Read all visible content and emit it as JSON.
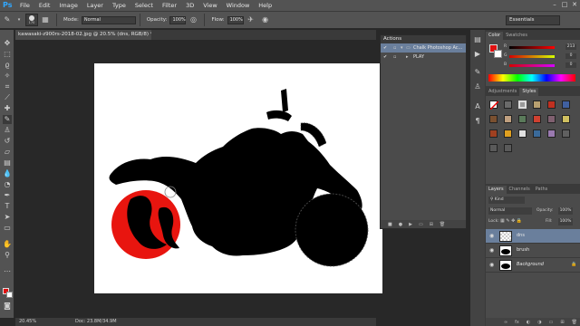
{
  "app": {
    "logo": "Ps",
    "menu": [
      "File",
      "Edit",
      "Image",
      "Layer",
      "Type",
      "Select",
      "Filter",
      "3D",
      "View",
      "Window",
      "Help"
    ],
    "window_controls": [
      "–",
      "□",
      "✕"
    ]
  },
  "options": {
    "brush_size": "170",
    "mode_label": "Mode:",
    "mode_value": "Normal",
    "opacity_label": "Opacity:",
    "opacity_value": "100%",
    "flow_label": "Flow:",
    "flow_value": "100%",
    "workspace": "Essentials"
  },
  "document": {
    "tab_title": "kawasaki-z900rs-2018-02.jpg @ 20.5% (dns, RGB/8) *",
    "zoom": "20.45%",
    "doc_info": "Doc: 23.8M/34.9M"
  },
  "colors": {
    "foreground": "#e01010",
    "background": "#ffffff",
    "accent_selected": "#6a7f9c"
  },
  "actions_panel": {
    "title": "Actions",
    "rows": [
      {
        "label": "Chalk Photoshop Ac...",
        "checked": "✔",
        "selected": true
      },
      {
        "label": "PLAY",
        "checked": "✔",
        "selected": false
      }
    ]
  },
  "color_panel": {
    "tabs": [
      "Color",
      "Swatches"
    ],
    "channels": [
      {
        "key": "R",
        "value": "213"
      },
      {
        "key": "G",
        "value": "0"
      },
      {
        "key": "B",
        "value": "0"
      }
    ]
  },
  "styles_panel": {
    "tabs": [
      "Adjustments",
      "Styles"
    ]
  },
  "layers_panel": {
    "tabs": [
      "Layers",
      "Channels",
      "Paths"
    ],
    "kind_label": "Kind",
    "blend_mode": "Normal",
    "opacity_label": "Opacity:",
    "opacity_value": "100%",
    "lock_label": "Lock:",
    "fill_label": "Fill:",
    "fill_value": "100%",
    "layers": [
      {
        "name": "dns",
        "selected": true
      },
      {
        "name": "brush",
        "selected": false
      },
      {
        "name": "Background",
        "selected": false
      }
    ]
  }
}
